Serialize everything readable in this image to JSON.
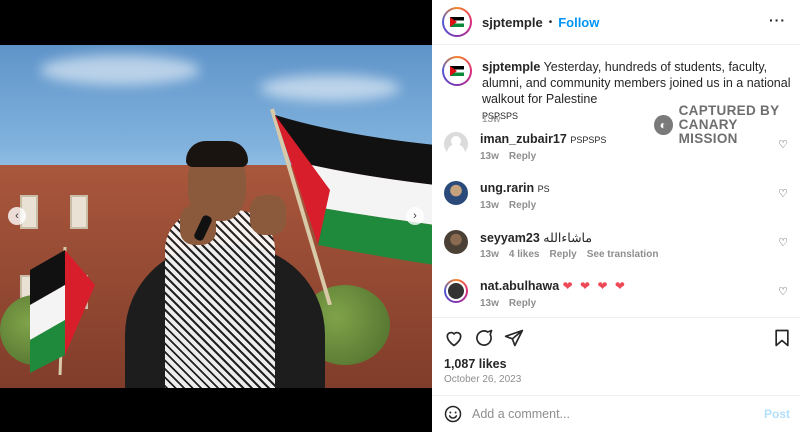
{
  "header": {
    "username": "sjptemple",
    "separator": "•",
    "follow_label": "Follow",
    "more_label": "···"
  },
  "caption": {
    "username": "sjptemple",
    "text": "Yesterday, hundreds of students, faculty, alumni, and community members joined us in a national walkout for Palestine",
    "tag": "PSPSPS",
    "time": "13w"
  },
  "watermark": {
    "line1": "CAPTURED BY",
    "line2": "CANARY MISSION"
  },
  "comments": [
    {
      "username": "iman_zubair17",
      "text": "PSPSPS",
      "time": "13w",
      "likes": "",
      "reply": "Reply",
      "translate": ""
    },
    {
      "username": "ung.rarin",
      "text": "PS",
      "time": "13w",
      "likes": "",
      "reply": "Reply",
      "translate": ""
    },
    {
      "username": "seyyam23",
      "text": "ماشاءالله",
      "time": "13w",
      "likes": "4 likes",
      "reply": "Reply",
      "translate": "See translation"
    },
    {
      "username": "nat.abulhawa",
      "text": "❤ ❤ ❤ ❤",
      "time": "13w",
      "likes": "",
      "reply": "Reply",
      "translate": ""
    }
  ],
  "post": {
    "likes": "1,087 likes",
    "date": "October 26, 2023"
  },
  "add_comment": {
    "placeholder": "Add a comment...",
    "post_label": "Post"
  },
  "carousel": {
    "prev_label": "‹",
    "next_label": "›",
    "slide_count": 10,
    "active_index": 3
  },
  "icons": {
    "like": "heart-icon",
    "comment": "comment-icon",
    "share": "share-icon",
    "save": "bookmark-icon",
    "emoji": "emoji-icon"
  },
  "colors": {
    "accent": "#0095f6",
    "heart": "#ed4956"
  }
}
